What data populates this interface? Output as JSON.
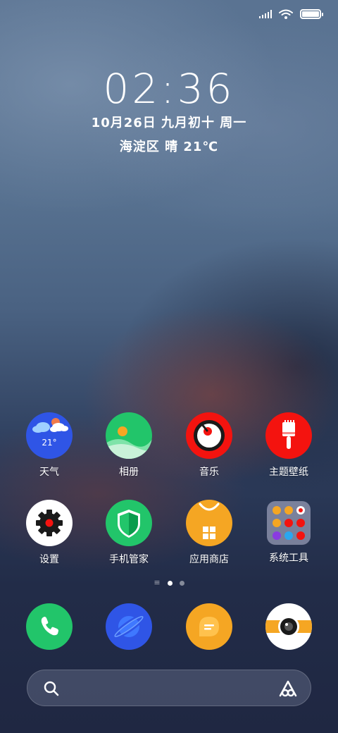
{
  "status_bar": {
    "signal_icon": "signal-icon",
    "wifi_icon": "wifi-icon",
    "battery_icon": "battery-icon",
    "battery_level": 1.0
  },
  "lockscreen": {
    "time": "02:36",
    "date": "10月26日 九月初十  周一",
    "weather": "海淀区  晴  21℃"
  },
  "apps": [
    {
      "label": "天气",
      "icon": "weather-icon",
      "temp": "21°",
      "color": "#2f55e6"
    },
    {
      "label": "相册",
      "icon": "gallery-icon",
      "color": "#22c56a"
    },
    {
      "label": "音乐",
      "icon": "music-icon",
      "color": "#f4130f"
    },
    {
      "label": "主题壁纸",
      "icon": "theme-icon",
      "color": "#f4130f"
    },
    {
      "label": "设置",
      "icon": "settings-icon",
      "color": "#ffffff"
    },
    {
      "label": "手机管家",
      "icon": "security-icon",
      "color": "#22c56a"
    },
    {
      "label": "应用商店",
      "icon": "app-store-icon",
      "color": "#f5a623"
    },
    {
      "label": "系统工具",
      "icon": "folder-icon",
      "color": "#8a8fa8"
    }
  ],
  "dock": [
    {
      "icon": "phone-icon",
      "color": "#22c56a"
    },
    {
      "icon": "browser-icon",
      "color": "#2f55e6"
    },
    {
      "icon": "messages-icon",
      "color": "#f5a623"
    },
    {
      "icon": "camera-icon",
      "color": "#ffffff"
    }
  ],
  "page_indicator": {
    "pages": 2,
    "active": 1
  },
  "search_bar": {
    "search_icon": "search-icon",
    "assistant_icon": "assistant-icon"
  }
}
